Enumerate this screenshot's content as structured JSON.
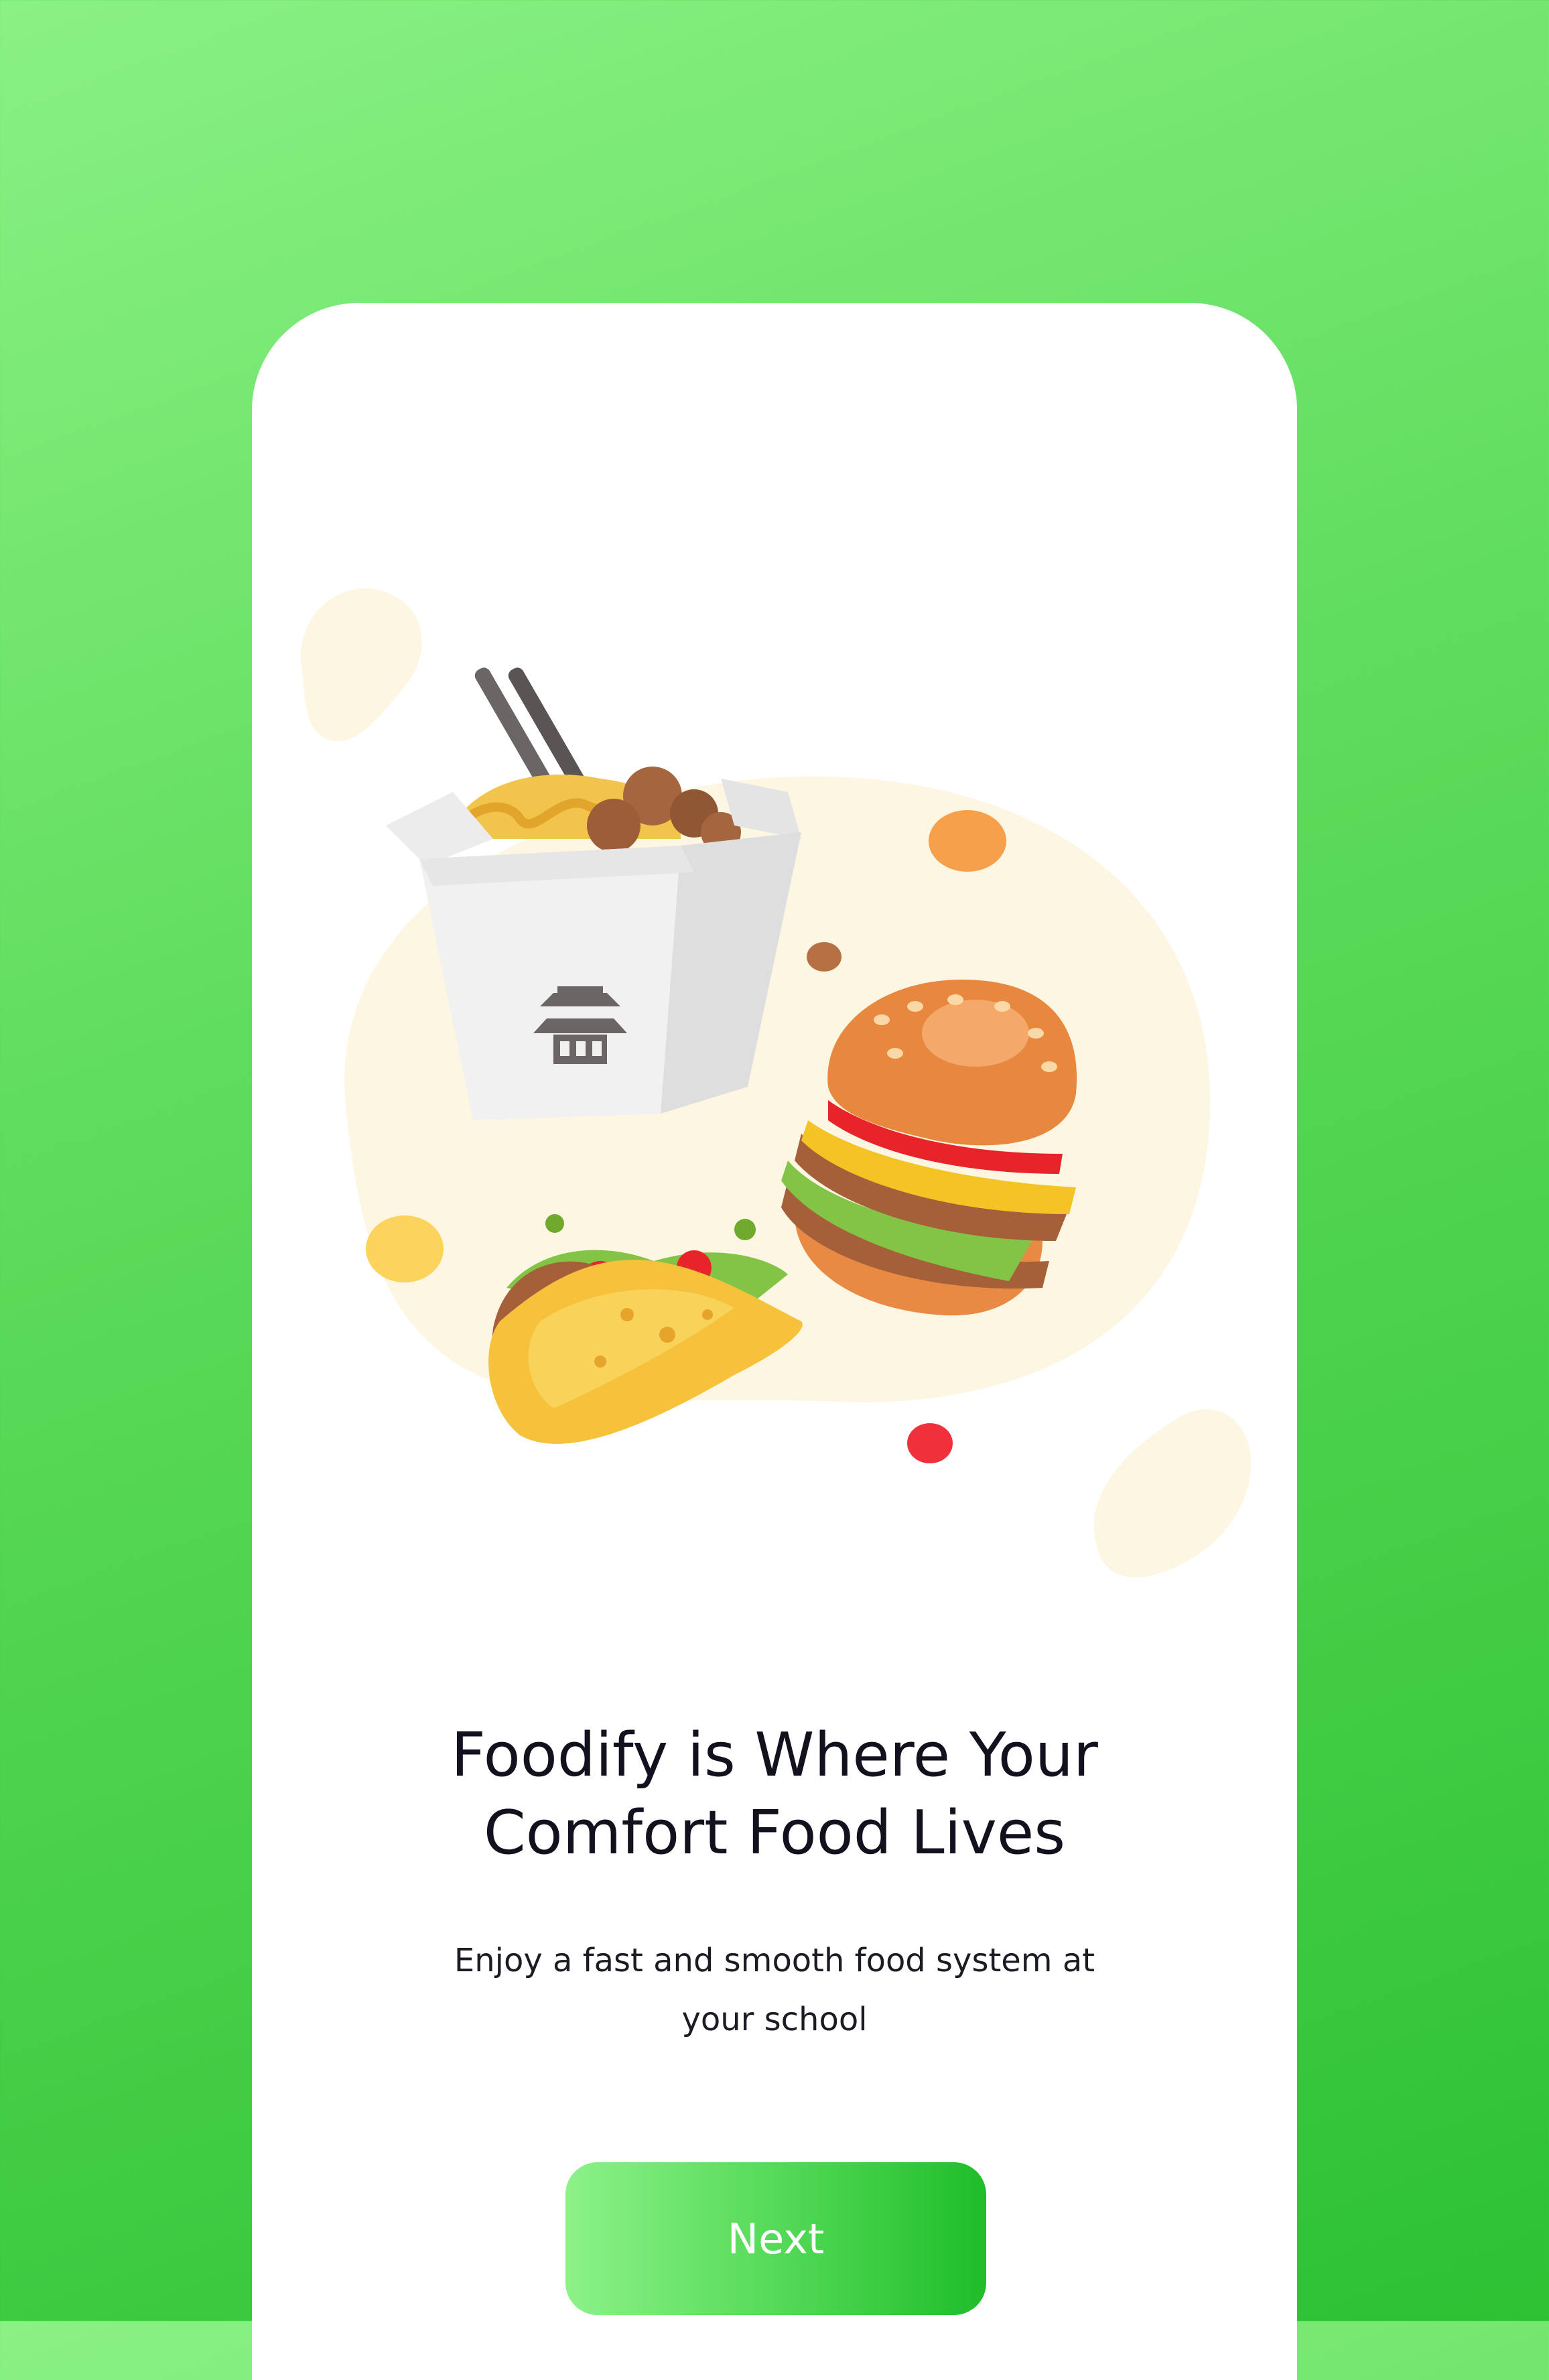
{
  "onboarding": {
    "title_line1": "Foodify is Where Your",
    "title_line2": "Comfort Food Lives",
    "subtitle": "Enjoy a fast and smooth food system at your school",
    "next_label": "Next"
  },
  "illustration": {
    "items": [
      "noodle-box",
      "burger",
      "taco"
    ]
  },
  "colors": {
    "background_start": "#8af184",
    "background_end": "#2dc134",
    "card": "#ffffff",
    "blob": "#fdf6e3",
    "button_start": "#8cf289",
    "button_end": "#1fbd2a",
    "title_text": "#12121f"
  }
}
